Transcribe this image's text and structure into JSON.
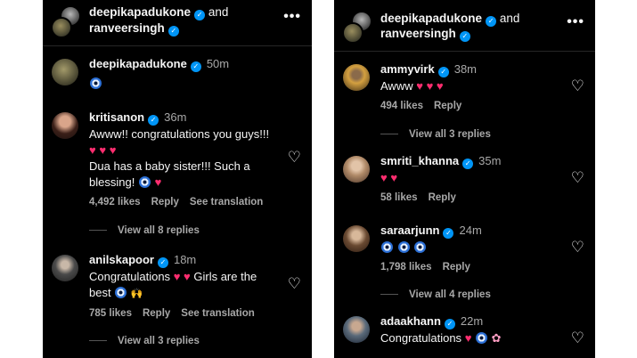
{
  "left": {
    "header": {
      "user1": "deepikapadukone",
      "and": "and",
      "user2": "ranveersingh",
      "more": "•••"
    },
    "caption": {
      "user": "deepikapadukone",
      "time": "50m"
    },
    "comments": [
      {
        "user": "kritisanon",
        "time": "36m",
        "line1": "Awww!! congratulations you guys!!!",
        "line2": "Dua has a baby sister!!! Such a",
        "line3": "blessing!",
        "likes": "4,492 likes",
        "reply": "Reply",
        "translate": "See translation",
        "view_replies": "View all 8 replies"
      },
      {
        "user": "anilskapoor",
        "time": "18m",
        "line1a": "Congratulations",
        "line1b": "Girls are the",
        "line2": "best",
        "likes": "785 likes",
        "reply": "Reply",
        "translate": "See translation",
        "view_replies": "View all 3 replies"
      }
    ]
  },
  "right": {
    "header": {
      "user1": "deepikapadukone",
      "and": "and",
      "user2": "ranveersingh",
      "more": "•••"
    },
    "comments": [
      {
        "user": "ammyvirk",
        "time": "38m",
        "text": "Awww",
        "likes": "494 likes",
        "reply": "Reply",
        "view_replies": "View all 3 replies"
      },
      {
        "user": "smriti_khanna",
        "time": "35m",
        "likes": "58 likes",
        "reply": "Reply"
      },
      {
        "user": "saraarjunn",
        "time": "24m",
        "likes": "1,798 likes",
        "reply": "Reply",
        "view_replies": "View all 4 replies"
      },
      {
        "user": "adaakhann",
        "time": "22m",
        "text": "Congratulations"
      }
    ]
  },
  "icons": {
    "verified": "verified-badge-icon",
    "heart_outline": "heart-outline-icon",
    "more": "more-options-icon"
  },
  "colors": {
    "background": "#000000",
    "verified": "#0095f6",
    "secondary_text": "#a8a8a8",
    "heart_emoji": "#ff2d6f"
  }
}
